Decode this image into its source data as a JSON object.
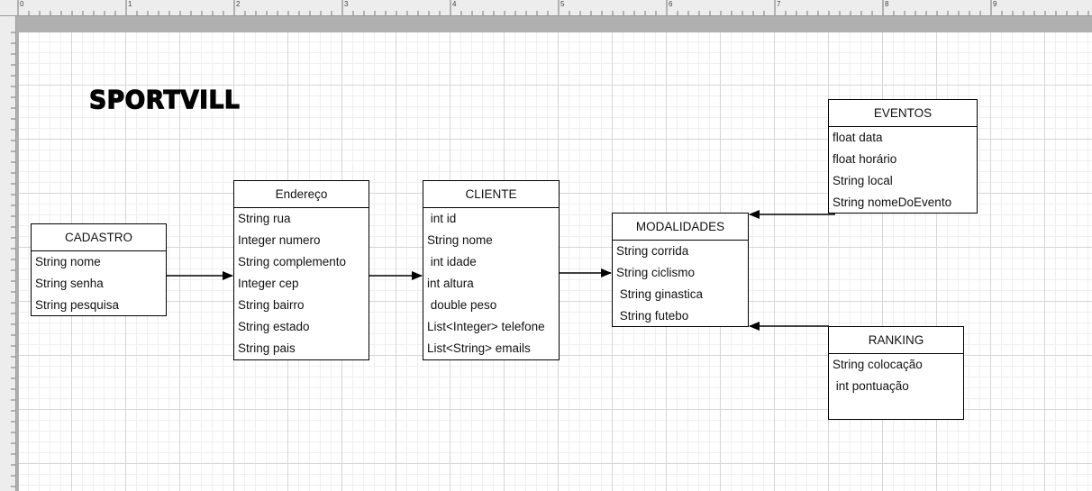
{
  "ruler": {
    "marks": [
      "0",
      "1",
      "2",
      "3",
      "4",
      "5",
      "6",
      "7",
      "8",
      "9"
    ]
  },
  "diagram": {
    "title": "SPORTVILL",
    "classes": {
      "cadastro": {
        "name": "CADASTRO",
        "attributes": [
          "String nome",
          "String senha",
          "String pesquisa"
        ]
      },
      "endereco": {
        "name": "Endereço",
        "attributes": [
          "String rua",
          "Integer numero",
          "String complemento",
          "Integer cep",
          "String bairro",
          "String estado",
          "String pais"
        ]
      },
      "cliente": {
        "name": "CLIENTE",
        "attributes": [
          " int id",
          "String nome",
          " int idade",
          "int altura",
          " double peso",
          "List<Integer> telefone",
          "List<String> emails"
        ]
      },
      "modalidades": {
        "name": "MODALIDADES",
        "attributes": [
          "String corrida",
          "String ciclismo",
          " String ginastica",
          " String futebo"
        ]
      },
      "eventos": {
        "name": "EVENTOS",
        "attributes": [
          "float data",
          "float horário",
          "String local",
          "String nomeDoEvento"
        ]
      },
      "ranking": {
        "name": "RANKING",
        "attributes": [
          "String colocação",
          " int pontuação"
        ]
      }
    }
  }
}
